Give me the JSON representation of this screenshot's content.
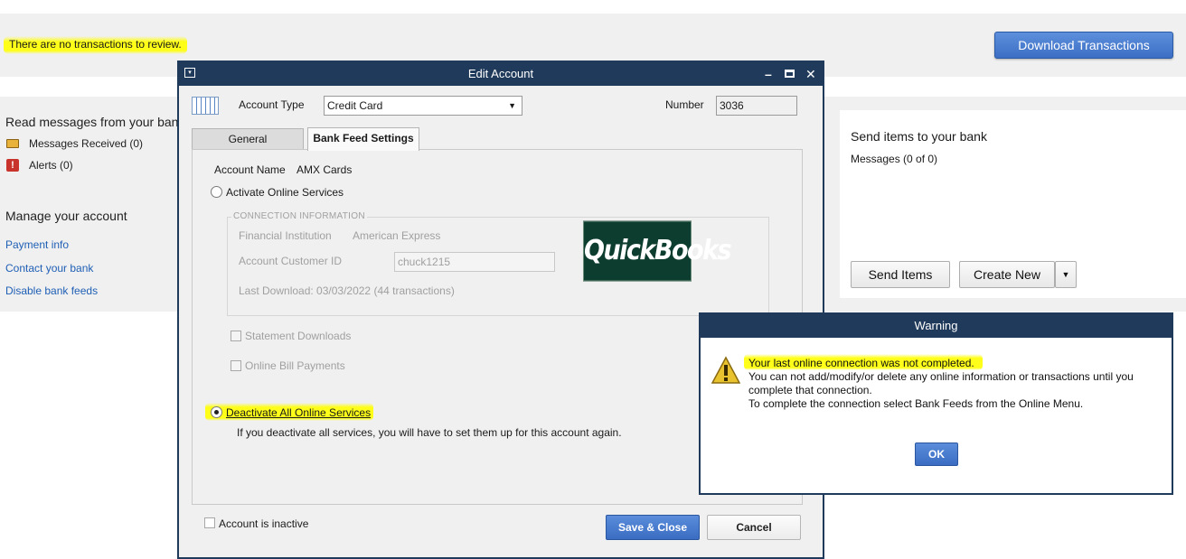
{
  "top": {
    "message": "There are no transactions to review.",
    "download_button": "Download Transactions"
  },
  "left_panel": {
    "read_messages_heading": "Read messages from your bank",
    "messages_received": "Messages Received (0)",
    "alerts": "Alerts (0)",
    "manage_heading": "Manage your account",
    "links": [
      "Payment info",
      "Contact your bank",
      "Disable bank feeds"
    ]
  },
  "right_panel": {
    "heading": "Send items to your bank",
    "messages": "Messages (0 of 0)",
    "send_items": "Send Items",
    "create_new": "Create New"
  },
  "edit_account": {
    "title": "Edit Account",
    "account_type_label": "Account Type",
    "account_type_value": "Credit Card",
    "number_label": "Number",
    "number_value": "3036",
    "tabs": [
      "General",
      "Bank Feed Settings"
    ],
    "account_name_label": "Account Name",
    "account_name_value": "AMX Cards",
    "activate_label": "Activate Online Services",
    "connection_info_label": "CONNECTION INFORMATION",
    "financial_institution_label": "Financial Institution",
    "financial_institution_value": "American Express",
    "customer_id_label": "Account Customer ID",
    "customer_id_value": "chuck1215",
    "last_download": "Last Download: 03/03/2022 (44 transactions)",
    "logo_text": "QuickBooks",
    "statement_downloads": "Statement Downloads",
    "online_bill_payments": "Online Bill Payments",
    "deactivate_label": "Deactivate All Online Services",
    "deactivate_note": "If you deactivate all services, you will have to set them up for this account again.",
    "inactive_label": "Account is inactive",
    "save_close": "Save & Close",
    "cancel": "Cancel"
  },
  "warning": {
    "title": "Warning",
    "line1": "Your last online connection was not completed.",
    "line2": "You can not add/modify/or delete any online information or transactions until you",
    "line3": "complete that connection.",
    "line4": "To complete the connection select Bank Feeds from the Online Menu.",
    "ok": "OK"
  }
}
